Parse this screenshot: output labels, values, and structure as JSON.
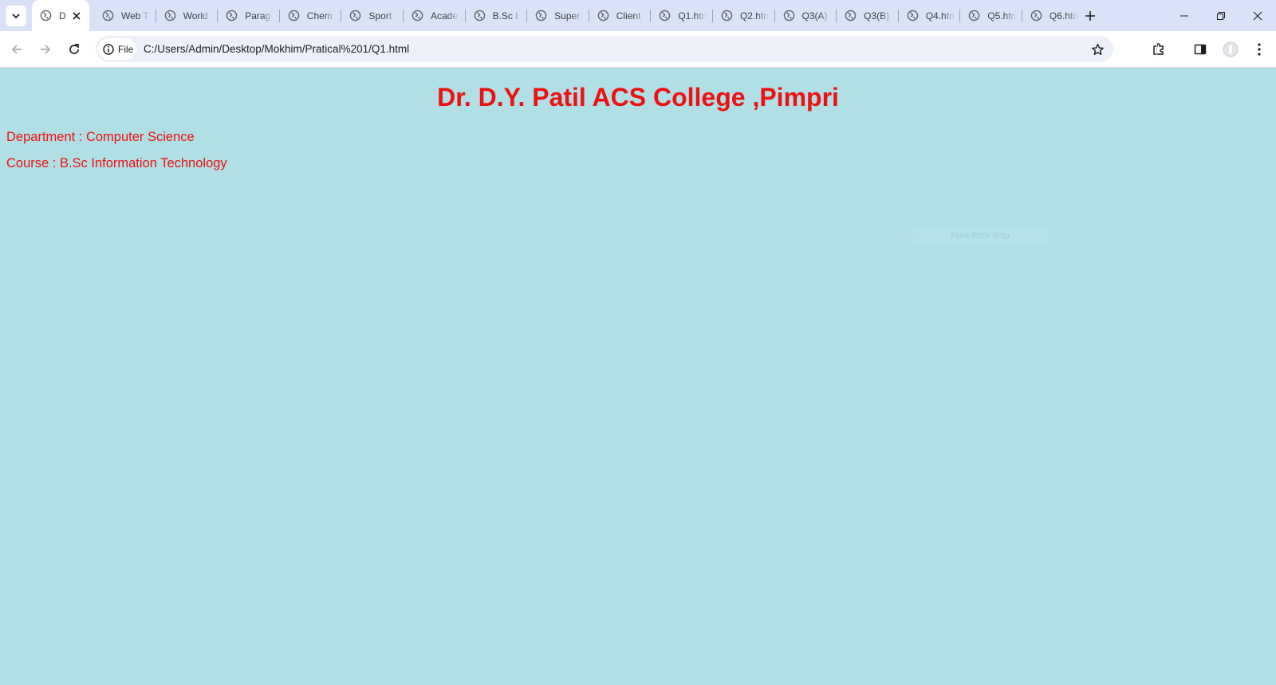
{
  "browser": {
    "tabs": [
      {
        "title": "D",
        "active": true
      },
      {
        "title": "Web T"
      },
      {
        "title": "World"
      },
      {
        "title": "Parag"
      },
      {
        "title": "Chem"
      },
      {
        "title": "Sport"
      },
      {
        "title": "Acade"
      },
      {
        "title": "B.Sc I"
      },
      {
        "title": "Super"
      },
      {
        "title": "Client"
      },
      {
        "title": "Q1.htm"
      },
      {
        "title": "Q2.htm"
      },
      {
        "title": "Q3(A)"
      },
      {
        "title": "Q3(B)"
      },
      {
        "title": "Q4.htm"
      },
      {
        "title": "Q5.htm"
      },
      {
        "title": "Q6.htm"
      }
    ],
    "address": {
      "chip_label": "File",
      "url": "C:/Users/Admin/Desktop/Mokhim/Pratical%201/Q1.html"
    },
    "icons": [
      "tab-search-icon",
      "globe-icon",
      "close-icon",
      "plus-icon",
      "minimize-icon",
      "restore-icon",
      "window-close-icon",
      "back-icon",
      "forward-icon",
      "reload-icon",
      "info-icon",
      "star-icon",
      "extensions-icon",
      "side-panel-icon",
      "profile-icon",
      "menu-icon"
    ]
  },
  "page": {
    "heading": "Dr. D.Y. Patil ACS College ,Pimpri",
    "department_line": "Department : Computer Science",
    "course_line": "Course : B.Sc Information Technology",
    "overlay_text": "Free-form Snip",
    "colors": {
      "background": "#b0dfe5",
      "text": "#ee1111",
      "tabstrip": "#dae2f8"
    }
  }
}
